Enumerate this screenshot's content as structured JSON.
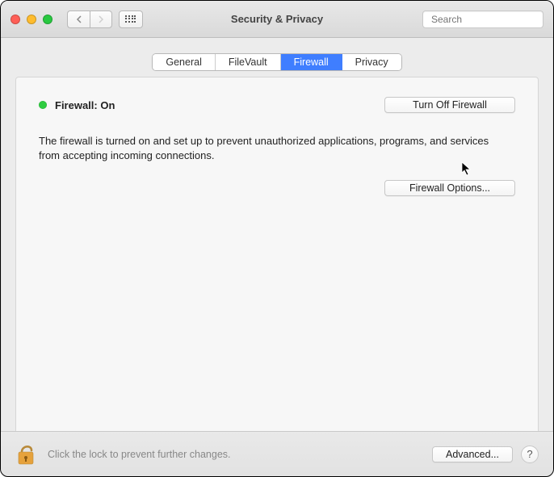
{
  "window": {
    "title": "Security & Privacy"
  },
  "search": {
    "placeholder": "Search"
  },
  "tabs": {
    "general": "General",
    "filevault": "FileVault",
    "firewall": "Firewall",
    "privacy": "Privacy",
    "active": "firewall"
  },
  "firewall": {
    "status_label": "Firewall: On",
    "status_color": "#2ecc40",
    "turn_off_label": "Turn Off Firewall",
    "description": "The firewall is turned on and set up to prevent unauthorized applications, programs, and services from accepting incoming connections.",
    "options_label": "Firewall Options..."
  },
  "footer": {
    "lock_hint": "Click the lock to prevent further changes.",
    "advanced_label": "Advanced...",
    "help_label": "?"
  }
}
